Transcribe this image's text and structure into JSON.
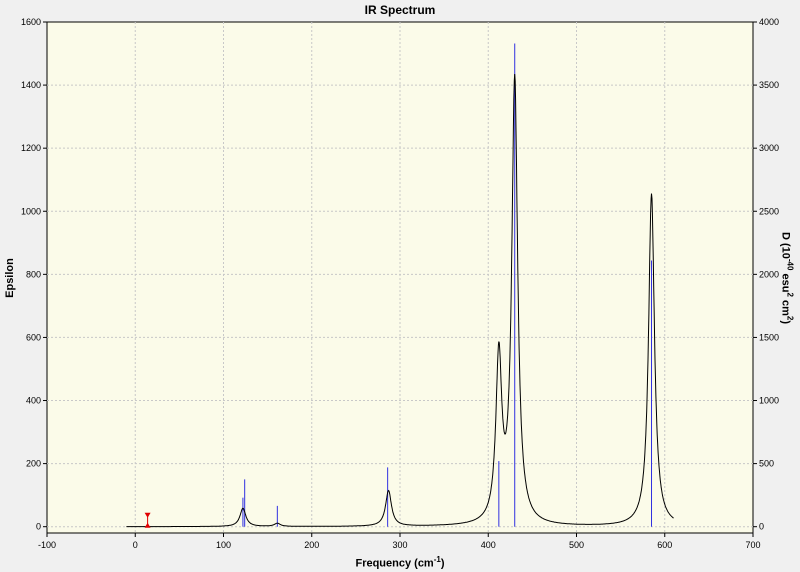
{
  "chart_data": {
    "type": "line",
    "title": "IR Spectrum",
    "xlabel": "Frequency (cm",
    "xlabel_sup": "-1",
    "xlabel_tail": ")",
    "ylabel": "Epsilon",
    "ylabel_right": "D (10",
    "ylabel_right_sup1": "-40",
    "ylabel_right_mid": " esu",
    "ylabel_right_sup2": "2",
    "ylabel_right_mid2": " cm",
    "ylabel_right_sup3": "2",
    "ylabel_right_tail": ")",
    "xlim": [
      -100,
      700
    ],
    "ylim": [
      -20,
      1600
    ],
    "ylim_right": [
      -50,
      4000
    ],
    "x_ticks": [
      -100,
      0,
      100,
      200,
      300,
      400,
      500,
      600,
      700
    ],
    "y_ticks": [
      0,
      200,
      400,
      600,
      800,
      1000,
      1200,
      1400,
      1600
    ],
    "y_ticks_right": [
      0,
      500,
      1000,
      1500,
      2000,
      2500,
      3000,
      3500,
      4000
    ],
    "grid": true,
    "spectrum_range": [
      -10,
      610
    ],
    "peaks": [
      {
        "freq": 122,
        "height": 58,
        "hwhm": 4
      },
      {
        "freq": 161,
        "height": 10,
        "hwhm": 4
      },
      {
        "freq": 287,
        "height": 113,
        "hwhm": 4
      },
      {
        "freq": 412,
        "height": 520,
        "hwhm": 4
      },
      {
        "freq": 430,
        "height": 1410,
        "hwhm": 4
      },
      {
        "freq": 585,
        "height": 1055,
        "hwhm": 4
      }
    ],
    "stick_series": {
      "name": "",
      "color": "#3030e0",
      "points": [
        {
          "freq": 122,
          "intensity": 230
        },
        {
          "freq": 124,
          "intensity": 375
        },
        {
          "freq": 161,
          "intensity": 165
        },
        {
          "freq": 286,
          "intensity": 470
        },
        {
          "freq": 412,
          "intensity": 520
        },
        {
          "freq": 430,
          "intensity": 3830
        },
        {
          "freq": 585,
          "intensity": 2110
        }
      ]
    },
    "marker": {
      "freq": 14,
      "color": "#e00000"
    },
    "colors": {
      "plot_bg": "#fbfbe9",
      "grid": "#c8c8c8",
      "curve": "#000000",
      "sticks": "#3030e0"
    }
  }
}
